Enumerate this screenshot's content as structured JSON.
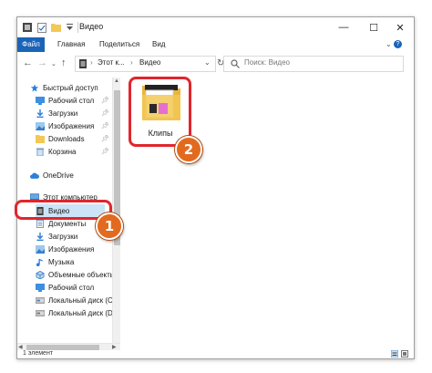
{
  "window": {
    "title": "Видео",
    "ribbon_tabs": [
      "Файл",
      "Главная",
      "Поделиться",
      "Вид"
    ],
    "controls": {
      "minimize": "—",
      "maximize": "☐",
      "close": "✕",
      "collapse": "⌄",
      "help": "?"
    }
  },
  "address_bar": {
    "crumbs": [
      "Этот к...",
      "Видео"
    ],
    "search_placeholder": "Поиск: Видео"
  },
  "sidebar": {
    "items": [
      {
        "label": "Быстрый доступ",
        "icon": "star-icon",
        "pinned": false
      },
      {
        "label": "Рабочий стол",
        "icon": "desktop-folder-icon",
        "pinned": true
      },
      {
        "label": "Загрузки",
        "icon": "downloads-icon",
        "pinned": true
      },
      {
        "label": "Изображения",
        "icon": "pictures-icon",
        "pinned": true
      },
      {
        "label": "Downloads",
        "icon": "folder-icon",
        "pinned": true
      },
      {
        "label": "Корзина",
        "icon": "recycle-bin-icon",
        "pinned": true
      },
      {
        "label": "OneDrive",
        "icon": "cloud-icon",
        "pinned": false
      },
      {
        "label": "Этот компьютер",
        "icon": "computer-icon",
        "pinned": false
      },
      {
        "label": "Видео",
        "icon": "video-folder-icon",
        "pinned": false
      },
      {
        "label": "Документы",
        "icon": "documents-icon",
        "pinned": false
      },
      {
        "label": "Загрузки",
        "icon": "downloads-icon",
        "pinned": false
      },
      {
        "label": "Изображения",
        "icon": "pictures-icon",
        "pinned": false
      },
      {
        "label": "Музыка",
        "icon": "music-icon",
        "pinned": false
      },
      {
        "label": "Объемные объекты",
        "icon": "3d-objects-icon",
        "pinned": false
      },
      {
        "label": "Рабочий стол",
        "icon": "desktop-folder-icon",
        "pinned": false
      },
      {
        "label": "Локальный диск (C",
        "icon": "drive-icon",
        "pinned": false
      },
      {
        "label": "Локальный диск (D",
        "icon": "drive-icon",
        "pinned": false
      }
    ]
  },
  "content": {
    "folders": [
      {
        "label": "Клипы",
        "icon": "folder-with-media-icon"
      }
    ]
  },
  "status": {
    "text": "1 элемент"
  },
  "annotations": [
    {
      "label": "1"
    },
    {
      "label": "2"
    }
  ],
  "colors": {
    "accent": "#1a64b8",
    "highlight": "#e0262d",
    "badge": "#e26a1f",
    "folder": "#f3c855"
  }
}
